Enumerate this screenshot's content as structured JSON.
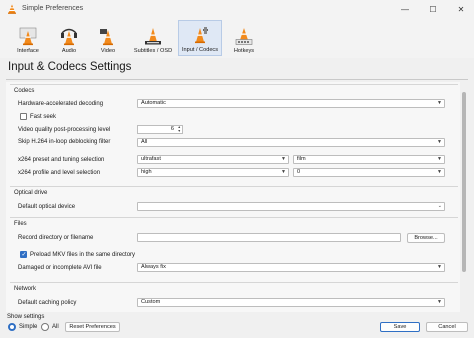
{
  "window": {
    "title": "Simple Preferences"
  },
  "toolbar": {
    "items": [
      {
        "label": "Interface",
        "icon": "interface-cone-icon"
      },
      {
        "label": "Audio",
        "icon": "audio-cone-icon"
      },
      {
        "label": "Video",
        "icon": "video-cone-icon"
      },
      {
        "label": "Subtitles / OSD",
        "icon": "subtitles-cone-icon"
      },
      {
        "label": "Input / Codecs",
        "icon": "codecs-cone-icon",
        "active": true
      },
      {
        "label": "Hotkeys",
        "icon": "hotkeys-cone-icon"
      }
    ]
  },
  "panel": {
    "title": "Input & Codecs Settings"
  },
  "codecs": {
    "group_title": "Codecs",
    "hw_decoding_label": "Hardware-accelerated decoding",
    "hw_decoding_value": "Automatic",
    "fast_seek_label": "Fast seek",
    "fast_seek_checked": false,
    "vq_label": "Video quality post-processing level",
    "vq_value": "6",
    "skip_h264_label": "Skip H.264 in-loop deblocking filter",
    "skip_h264_value": "All",
    "x264_preset_label": "x264 preset and tuning selection",
    "x264_preset_value": "ultrafast",
    "x264_tune_value": "film",
    "x264_profile_label": "x264 profile and level selection",
    "x264_profile_value": "high",
    "x264_level_value": "0"
  },
  "optical": {
    "group_title": "Optical drive",
    "device_label": "Default optical device",
    "device_value": ""
  },
  "files": {
    "group_title": "Files",
    "record_label": "Record directory or filename",
    "record_value": "",
    "browse_label": "Browse...",
    "preload_label": "Preload MKV files in the same directory",
    "preload_checked": true,
    "damaged_label": "Damaged or incomplete AVI file",
    "damaged_value": "Always fix"
  },
  "network": {
    "group_title": "Network",
    "caching_label": "Default caching policy",
    "caching_value": "Custom"
  },
  "footer": {
    "show_settings_label": "Show settings",
    "simple_label": "Simple",
    "all_label": "All",
    "reset_label": "Reset Preferences",
    "save_label": "Save",
    "cancel_label": "Cancel"
  },
  "colors": {
    "accent": "#2f6fc4",
    "cone_orange": "#f28a1c"
  }
}
